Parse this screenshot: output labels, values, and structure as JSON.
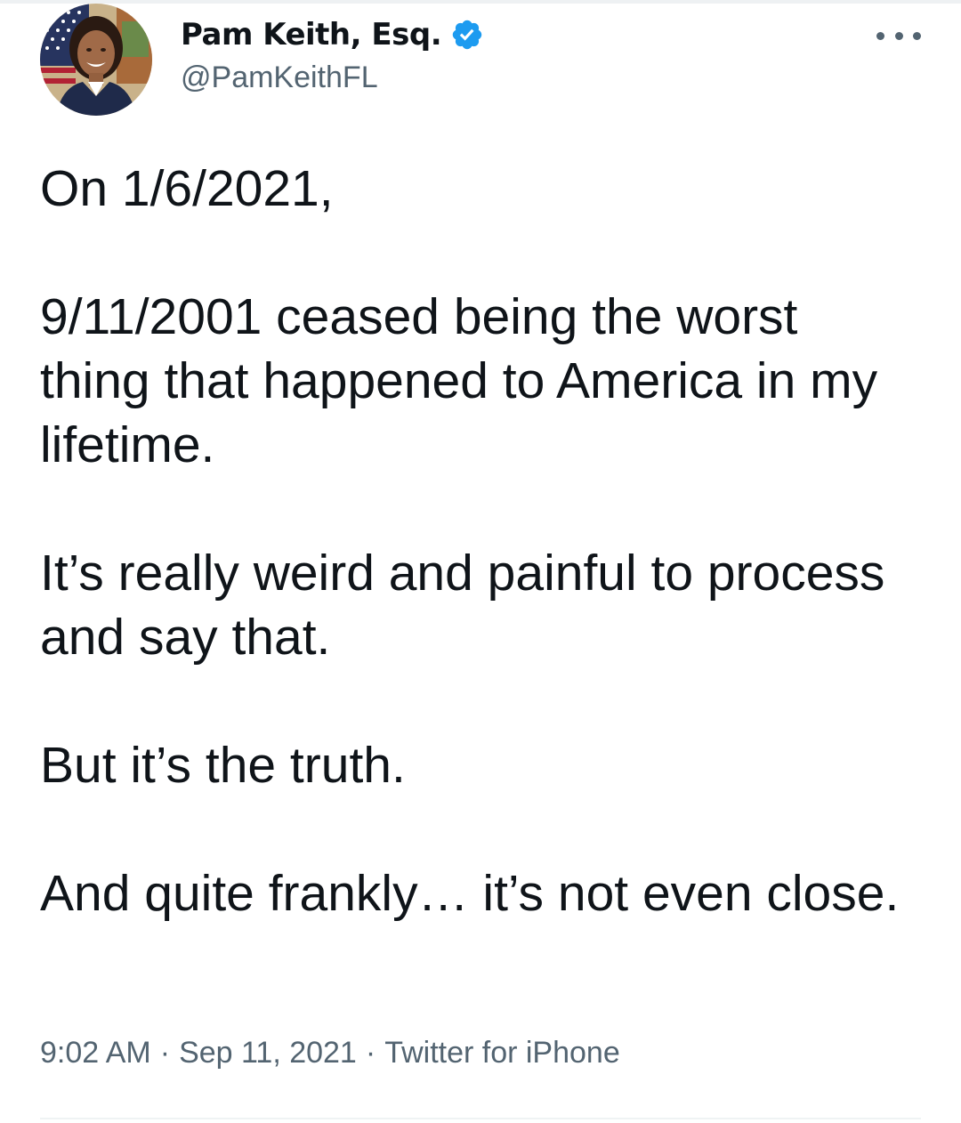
{
  "author": {
    "display_name": "Pam Keith, Esq.",
    "handle": "@PamKeithFL",
    "verified_icon": "verified-badge-icon",
    "verified_color": "#1d9bf0"
  },
  "more_icon": "more-options-icon",
  "tweet": {
    "paragraphs": [
      "On 1/6/2021,",
      "9/11/2001 ceased being the worst thing that happened to America in my lifetime.",
      "It’s really weird and painful to process and say that.",
      "But it’s the truth.",
      "And quite frankly… it’s not even close."
    ],
    "time": "9:02 AM",
    "separator": "·",
    "date": "Sep 11, 2021",
    "source": "Twitter for iPhone"
  },
  "colors": {
    "text_primary": "#0f1419",
    "text_secondary": "#536471",
    "divider": "#eff3f4"
  }
}
